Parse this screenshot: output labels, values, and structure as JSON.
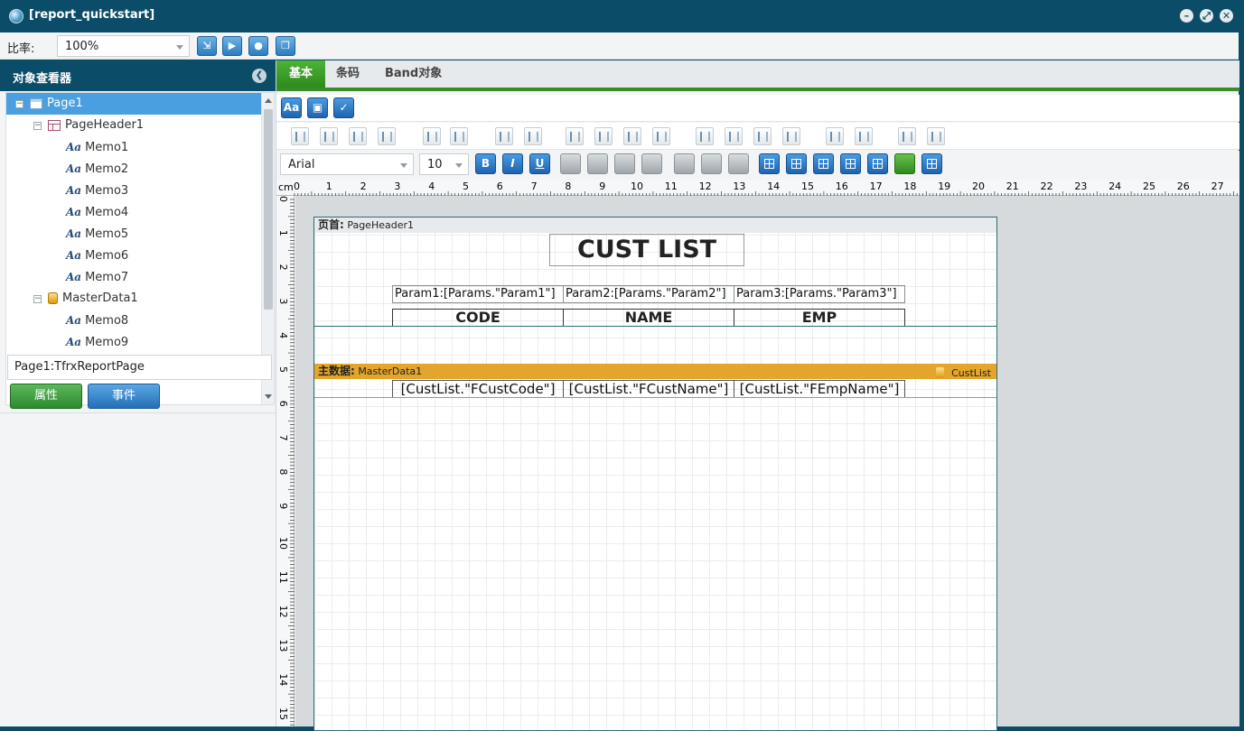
{
  "window": {
    "title": "[report_quickstart]"
  },
  "toolbar": {
    "zoom_label": "比率:",
    "zoom_value": "100%"
  },
  "inspector": {
    "title": "对象查看器",
    "tree": [
      {
        "label": "Page1",
        "level": 0,
        "type": "page",
        "selected": true
      },
      {
        "label": "PageHeader1",
        "level": 1,
        "type": "band"
      },
      {
        "label": "Memo1",
        "level": 2,
        "type": "memo"
      },
      {
        "label": "Memo2",
        "level": 2,
        "type": "memo"
      },
      {
        "label": "Memo3",
        "level": 2,
        "type": "memo"
      },
      {
        "label": "Memo4",
        "level": 2,
        "type": "memo"
      },
      {
        "label": "Memo5",
        "level": 2,
        "type": "memo"
      },
      {
        "label": "Memo6",
        "level": 2,
        "type": "memo"
      },
      {
        "label": "Memo7",
        "level": 2,
        "type": "memo"
      },
      {
        "label": "MasterData1",
        "level": 1,
        "type": "data"
      },
      {
        "label": "Memo8",
        "level": 2,
        "type": "memo"
      },
      {
        "label": "Memo9",
        "level": 2,
        "type": "memo"
      }
    ],
    "memo_glyph": "Aa",
    "selected_object": "Page1:TfrxReportPage",
    "props_button": "属性",
    "events_button": "事件"
  },
  "tabs": [
    "基本",
    "条码",
    "Band对象"
  ],
  "format": {
    "font_name": "Arial",
    "font_size": "10",
    "bold": "B",
    "italic": "I",
    "underline": "U"
  },
  "ruler": {
    "unit": "cm",
    "h_ticks": [
      "0",
      "1",
      "2",
      "3",
      "4",
      "5",
      "6",
      "7",
      "8",
      "9",
      "10",
      "11",
      "12",
      "13",
      "14",
      "15",
      "16",
      "17",
      "18",
      "19",
      "20",
      "21",
      "22",
      "23",
      "24",
      "25",
      "26",
      "27"
    ],
    "v_ticks": [
      "0",
      "1",
      "2",
      "3",
      "4",
      "5",
      "6",
      "7",
      "8",
      "9",
      "10",
      "11",
      "12",
      "13",
      "14",
      "15"
    ]
  },
  "report": {
    "page_header": {
      "prefix": "页首:",
      "name": "PageHeader1"
    },
    "title": "CUST LIST",
    "params": [
      "Param1:[Params.\"Param1\"]",
      "Param2:[Params.\"Param2\"]",
      "Param3:[Params.\"Param3\"]"
    ],
    "columns": [
      "CODE",
      "NAME",
      "EMP"
    ],
    "master_data": {
      "prefix": "主数据:",
      "name": "MasterData1",
      "dataset": "CustList"
    },
    "fields": [
      "[CustList.\"FCustCode\"]",
      "[CustList.\"FCustName\"]",
      "[CustList.\"FEmpName\"]"
    ]
  },
  "colors": {
    "titlebar": "#0b4d69",
    "accent_green": "#3d8b2a",
    "master_band": "#e3a52b",
    "selection": "#4a9fe0"
  }
}
